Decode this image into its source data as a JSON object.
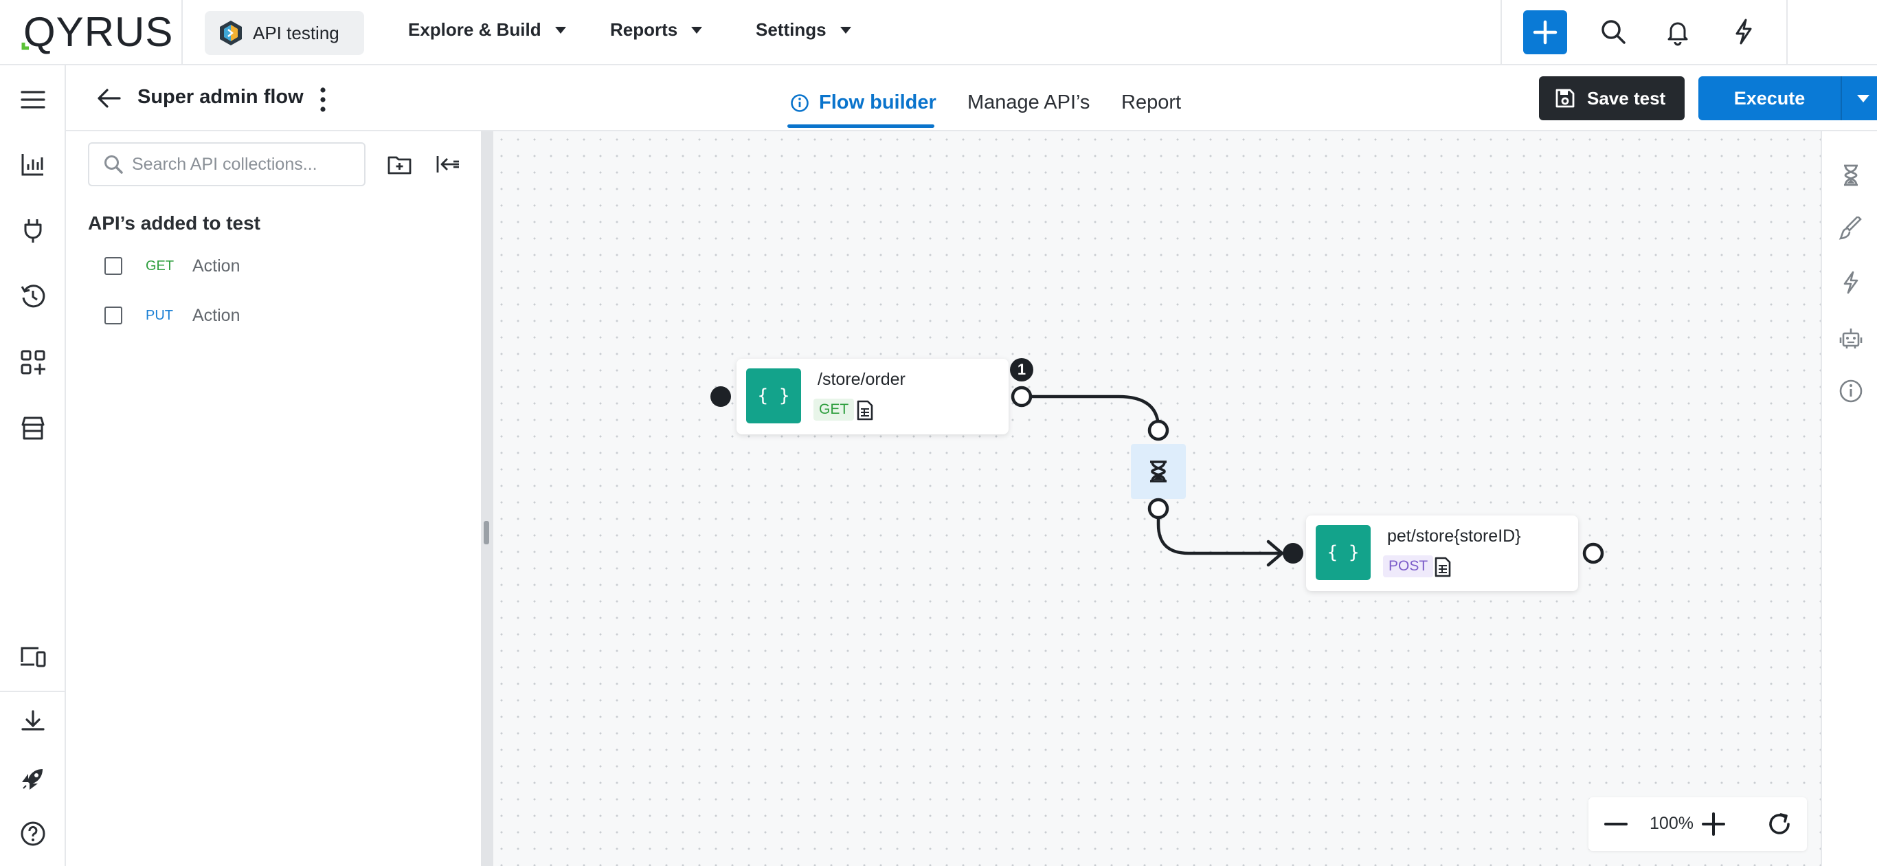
{
  "brand": {
    "logo_text": "QYRUS",
    "logo_accent": "#5bc236"
  },
  "topbar": {
    "app_label": "API testing",
    "menus": [
      "Explore & Build",
      "Reports",
      "Settings"
    ],
    "icons": [
      "plus-icon",
      "search-icon",
      "bell-icon",
      "lightning-icon"
    ],
    "accent": "#0a7ad6"
  },
  "rail": {
    "icons": [
      "hamburger-icon",
      "chart-icon",
      "plug-icon",
      "history-icon",
      "apps-add-icon",
      "store-icon",
      "devices-icon",
      "download-icon",
      "rocket-icon",
      "help-icon"
    ]
  },
  "header": {
    "title": "Super admin flow",
    "tabs": [
      {
        "label": "Flow builder",
        "active": true
      },
      {
        "label": "Manage API’s",
        "active": false
      },
      {
        "label": "Report",
        "active": false
      }
    ],
    "save_label": "Save test",
    "execute_label": "Execute"
  },
  "panel": {
    "search_placeholder": "Search API collections...",
    "section_title": "API’s added to test",
    "apis": [
      {
        "method": "GET",
        "name": "Action",
        "method_color": "#2e9e3e"
      },
      {
        "method": "PUT",
        "name": "Action",
        "method_color": "#1a7fd4"
      }
    ]
  },
  "canvas": {
    "nodes": [
      {
        "badge": "{ }",
        "path": "/store/order",
        "method": "GET",
        "method_color": "#2e9e3e",
        "method_bg": "#e8f5e9",
        "step": "1"
      },
      {
        "badge": "{ }",
        "path": "pet/store{storeID}",
        "method": "POST",
        "method_color": "#7b5cc9",
        "method_bg": "#efeafb"
      }
    ],
    "wait_icon": "hourglass-icon",
    "zoom_level": "100%"
  },
  "right_tools": [
    "hourglass-icon",
    "brush-icon",
    "lightning-icon",
    "robot-icon",
    "info-icon"
  ]
}
